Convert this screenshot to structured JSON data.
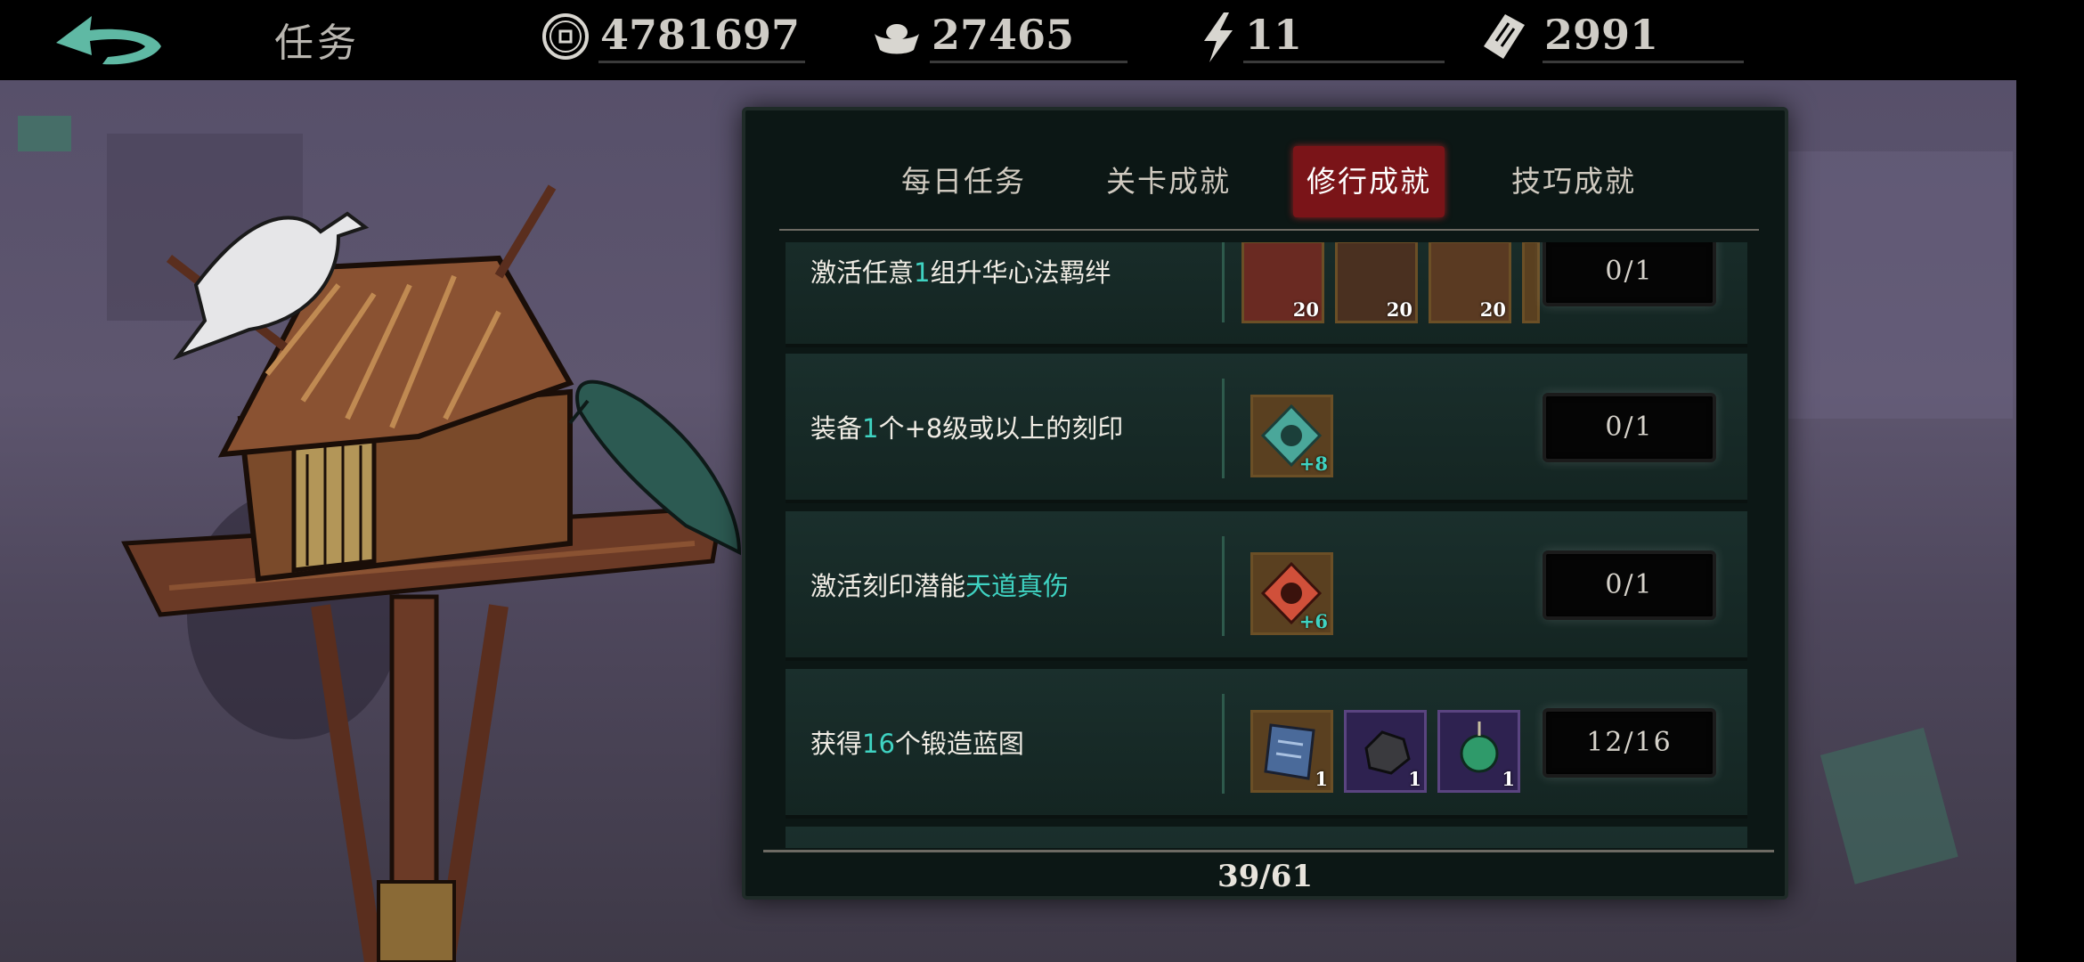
{
  "header": {
    "title": "任务",
    "resources": [
      {
        "icon": "coin-icon",
        "value": "4781697"
      },
      {
        "icon": "silver-ingot-icon",
        "value": "27465"
      },
      {
        "icon": "lightning-icon",
        "value": "11"
      },
      {
        "icon": "ticket-icon",
        "value": "2991"
      }
    ]
  },
  "tabs": [
    {
      "label": "每日任务",
      "active": false
    },
    {
      "label": "关卡成就",
      "active": false
    },
    {
      "label": "修行成就",
      "active": true
    },
    {
      "label": "技巧成就",
      "active": false
    }
  ],
  "tasks": [
    {
      "parts": [
        "激活任意",
        "1",
        "组升华心法羁绊"
      ],
      "rewards": [
        {
          "icon": "scroll-item-icon",
          "qty": "20"
        },
        {
          "icon": "cannon-item-icon",
          "qty": "20"
        },
        {
          "icon": "book-item-icon",
          "qty": "20"
        }
      ],
      "progress": "0/1"
    },
    {
      "parts": [
        "装备",
        "1",
        "个+8级或以上的刻印"
      ],
      "rewards": [
        {
          "icon": "teal-seal-icon",
          "qty": "+8"
        }
      ],
      "progress": "0/1"
    },
    {
      "parts": [
        "激活刻印潜能",
        "天道真伤",
        ""
      ],
      "rewards": [
        {
          "icon": "red-seal-icon",
          "qty": "+6"
        }
      ],
      "progress": "0/1"
    },
    {
      "parts": [
        "获得",
        "16",
        "个锻造蓝图"
      ],
      "rewards": [
        {
          "icon": "blueprint-scroll-icon",
          "qty": "1"
        },
        {
          "icon": "ore-icon",
          "qty": "1"
        },
        {
          "icon": "jade-pendant-icon",
          "qty": "1"
        }
      ],
      "progress": "12/16"
    }
  ],
  "page_count": "39/61",
  "colors": {
    "accent_teal": "#3fd3c2",
    "active_tab": "#7a1418",
    "panel_bg": "#0c1715"
  }
}
